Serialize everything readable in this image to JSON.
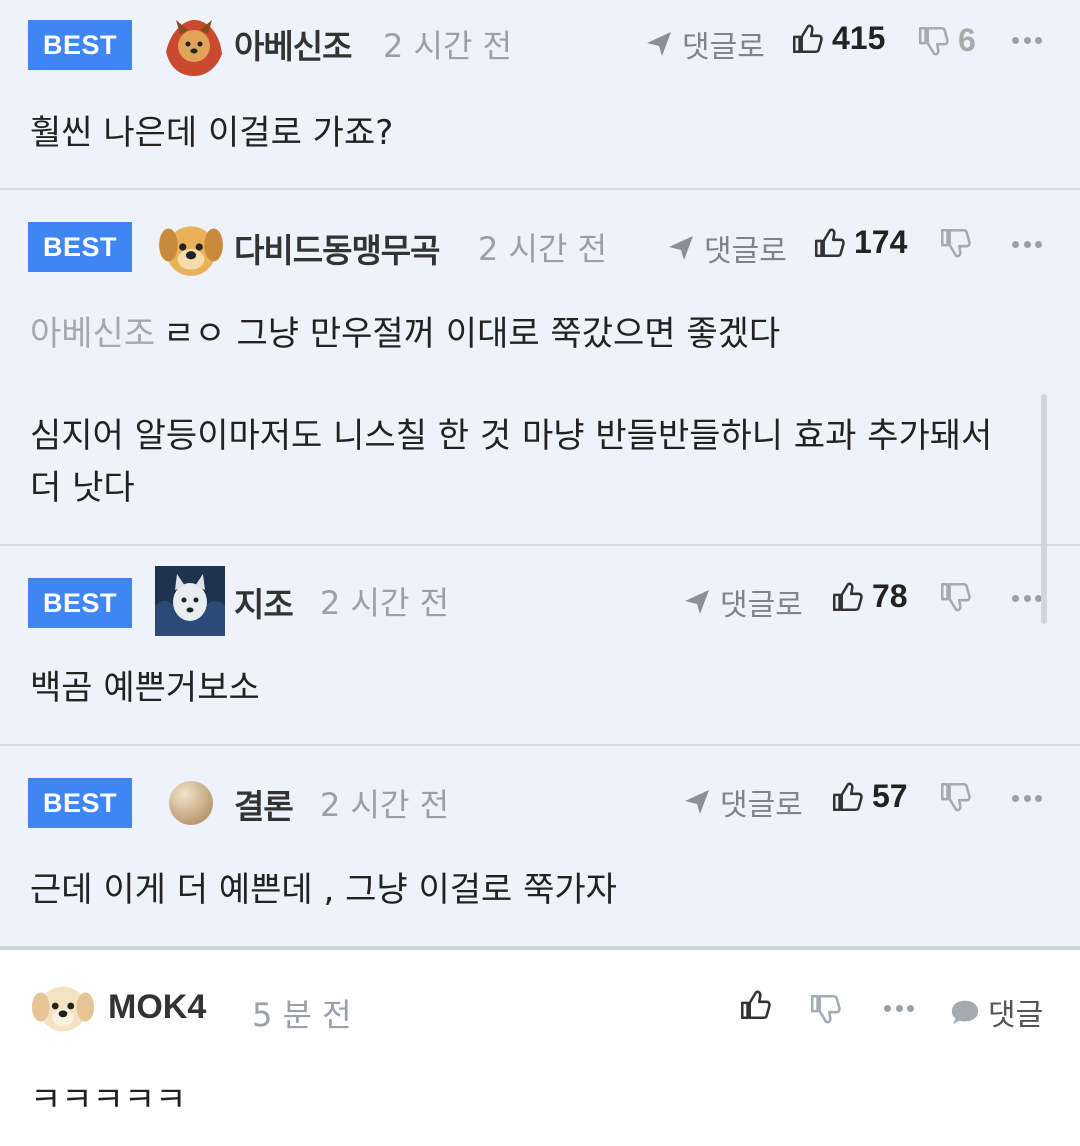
{
  "best_comments": [
    {
      "badge": "BEST",
      "nickname": "아베신조",
      "time": "2 시간 전",
      "reply_label": "댓글로",
      "likes": "415",
      "dislikes": "6",
      "quote_user": "",
      "paragraphs": [
        "훨씬 나은데 이걸로 가죠?"
      ]
    },
    {
      "badge": "BEST",
      "nickname": "다비드동맹무곡",
      "time": "2 시간 전",
      "reply_label": "댓글로",
      "likes": "174",
      "dislikes": "",
      "quote_user": "아베신조",
      "paragraphs": [
        "ㄹㅇ 그냥 만우절꺼 이대로 쭉갔으면 좋겠다",
        "심지어 알등이마저도 니스칠 한 것 마냥 반들반들하니 효과 추가돼서 더 낫다"
      ]
    },
    {
      "badge": "BEST",
      "nickname": "지조",
      "time": "2 시간 전",
      "reply_label": "댓글로",
      "likes": "78",
      "dislikes": "",
      "quote_user": "",
      "paragraphs": [
        "백곰 예쁜거보소"
      ]
    },
    {
      "badge": "BEST",
      "nickname": "결론",
      "time": "2 시간 전",
      "reply_label": "댓글로",
      "likes": "57",
      "dislikes": "",
      "quote_user": "",
      "paragraphs": [
        "근데 이게 더 예쁜데 , 그냥 이걸로 쭉가자"
      ]
    }
  ],
  "comment": {
    "nickname": "MOK4",
    "time": "5 분 전",
    "reply_label": "댓글",
    "text": "ㅋㅋㅋㅋㅋ"
  },
  "colors": {
    "best_badge": "#3f86f2",
    "best_background": "#eef2fb",
    "muted_text": "#9a9fa8"
  },
  "icons": [
    "reply-arrow-icon",
    "thumbs-up-icon",
    "thumbs-down-icon",
    "more-icon",
    "speech-bubble-icon"
  ]
}
